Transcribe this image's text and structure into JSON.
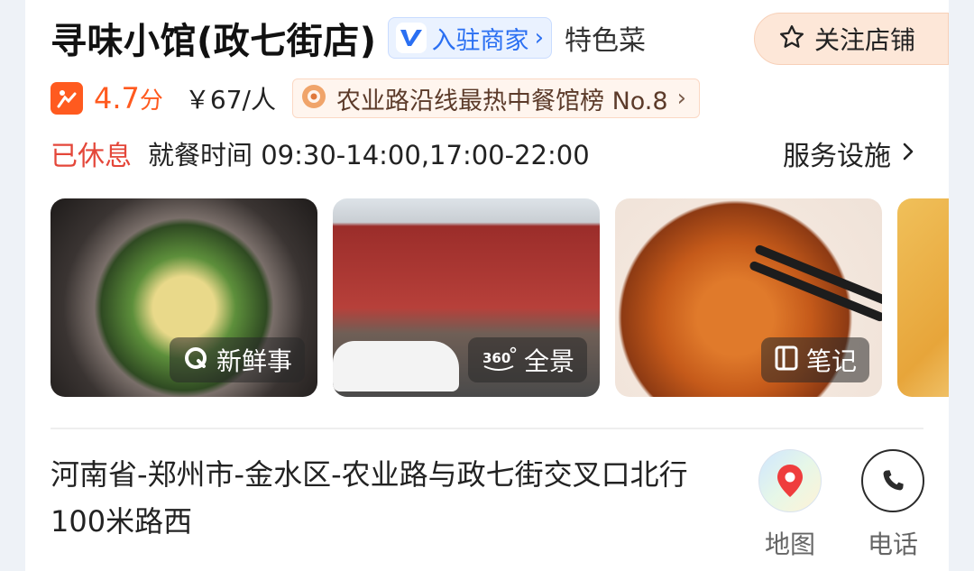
{
  "header": {
    "shop_name": "寻味小馆(政七街店)",
    "merchant_badge": "入驻商家",
    "feature_tag": "特色菜",
    "follow_label": "关注店铺"
  },
  "rating": {
    "score": "4.7",
    "score_unit": "分",
    "price": "￥67/人",
    "rank_text": "农业路沿线最热中餐馆榜 No.8"
  },
  "hours": {
    "status": "已休息",
    "text": "就餐时间 09:30-14:00,17:00-22:00",
    "facility_label": "服务设施"
  },
  "photos": [
    {
      "label": "新鲜事",
      "icon": "fresh-news-icon"
    },
    {
      "label": "全景",
      "icon": "panorama-360-icon"
    },
    {
      "label": "笔记",
      "icon": "note-icon"
    }
  ],
  "address": {
    "text": "河南省-郑州市-金水区-农业路与政七街交叉口北行100米路西"
  },
  "actions": {
    "map_label": "地图",
    "phone_label": "电话"
  },
  "colors": {
    "accent_orange": "#ff5a1f",
    "merchant_blue": "#2a6ff2",
    "closed_red": "#e4473a"
  }
}
